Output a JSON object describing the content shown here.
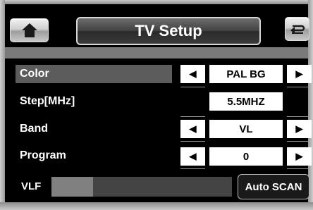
{
  "header": {
    "title": "TV Setup",
    "home_icon": "home-icon",
    "back_icon": "return-icon"
  },
  "settings": {
    "color": {
      "label": "Color",
      "value": "PAL BG"
    },
    "step": {
      "label": "Step[MHz]",
      "value": "5.5MHZ"
    },
    "band": {
      "label": "Band",
      "value": "VL"
    },
    "program": {
      "label": "Program",
      "value": "0"
    }
  },
  "arrows": {
    "left": "◀",
    "right": "▶"
  },
  "scan": {
    "label": "VLF",
    "progress_percent": 23,
    "button_label": "Auto SCAN"
  },
  "colors": {
    "accent_highlight": "#5c5c5c",
    "value_bg": "#ffffff",
    "background": "#000000"
  }
}
